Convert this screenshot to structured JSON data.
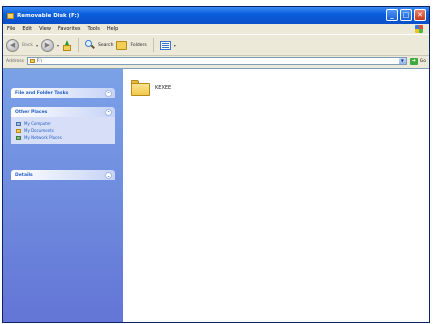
{
  "window": {
    "title": "Removable Disk (F:)"
  },
  "title_buttons": {
    "minimize": "_",
    "maximize": "□",
    "close": "✕"
  },
  "menubar": {
    "items": [
      "File",
      "Edit",
      "View",
      "Favorites",
      "Tools",
      "Help"
    ]
  },
  "toolbar": {
    "back_label": "Back",
    "search_label": "Search",
    "folders_label": "Folders"
  },
  "addressbar": {
    "label": "Address",
    "value": "F:\\",
    "go_label": "Go"
  },
  "taskpane": {
    "file_tasks_title": "File and Folder Tasks",
    "other_places_title": "Other Places",
    "other_places": [
      "My Computer",
      "My Documents",
      "My Network Places"
    ],
    "details_title": "Details"
  },
  "files": [
    {
      "name": "KEXEE",
      "type": "folder"
    }
  ],
  "colors": {
    "titlebar": "#0a5fdd",
    "taskpane": "#7ba2e7",
    "link": "#215dc6"
  }
}
